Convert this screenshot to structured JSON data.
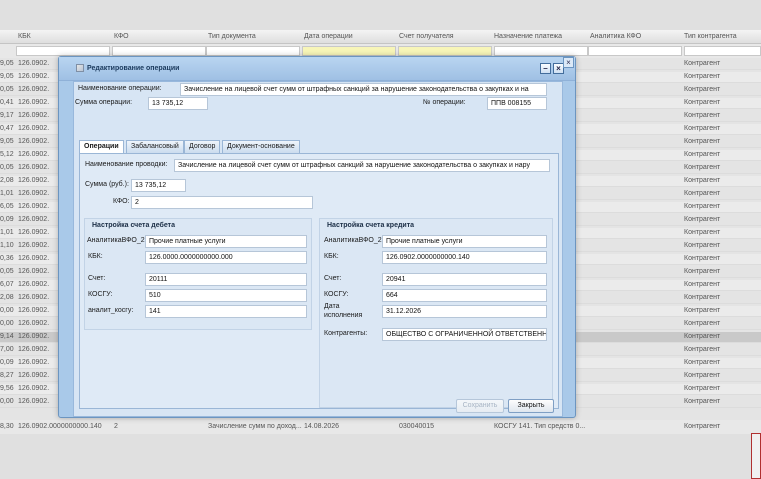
{
  "grid": {
    "columns": [
      "КБК",
      "КФО",
      "Тип документа",
      "Дата операции",
      "Счет получателя",
      "Назначение платежа",
      "Аналитика КФО",
      "Тип контрагента"
    ],
    "row_prefixes": [
      "9,05",
      "9,05",
      "0,05",
      "0,41",
      "9,17",
      "0,47",
      "9,05",
      "5,12",
      "0,05",
      "2,08",
      "1,01",
      "6,05",
      "0,09",
      "1,01",
      "1,10",
      "0,36",
      "0,05",
      "6,07",
      "2,08",
      "0,00",
      "0,00",
      "9,14",
      "7,00",
      "0,09",
      "8,27",
      "9,56",
      "0,00"
    ],
    "row_kbk": "126.0902.",
    "row_contr": "Контрагент",
    "last_row": {
      "prefix": "8,30",
      "kbk": "126.0902.0000000000.140",
      "kfo": "2",
      "doc": "Зачисление сумм по доход...",
      "date": "14.08.2026",
      "account": "030040015",
      "purpose": "КОСГУ 141. Тип средств 0...",
      "contr": "Контрагент"
    }
  },
  "dialog": {
    "title": "Редактирование операции",
    "op_name_label": "Наименование операции:",
    "op_name_value": "Зачисление на лицевой счет сумм от штрафных санкций за нарушение законодательства о закупках и на",
    "op_sum_label": "Сумма операции:",
    "op_sum_value": "13 735,12",
    "op_num_label": "№ операции:",
    "op_num_value": "ППВ 008155",
    "tabs": [
      "Операции",
      "Забалансовый",
      "Договор",
      "Документ-основание"
    ],
    "posting_name_label": "Наименование проводки:",
    "posting_name_value": "Зачисление на лицевой счет сумм от штрафных санкций за нарушение законодательства о закупках и нару",
    "sum_label": "Сумма (руб.):",
    "sum_value": "13 735,12",
    "kfo_label": "КФО:",
    "kfo_value": "2",
    "debit": {
      "title": "Настройка счета дебета",
      "analytics_label": "АналитикаВФО_2",
      "analytics_value": "Прочие платные услуги",
      "kbk_label": "КБК:",
      "kbk_value": "126.0000.0000000000.000",
      "account_label": "Счет:",
      "account_value": "20111",
      "kosgu_label": "КОСГУ:",
      "kosgu_value": "510",
      "akosgu_label": "аналит_косгу:",
      "akosgu_value": "141"
    },
    "credit": {
      "title": "Настройка счета кредита",
      "analytics_label": "АналитикаВФО_2",
      "analytics_value": "Прочие платные услуги",
      "kbk_label": "КБК:",
      "kbk_value": "126.0902.0000000000.140",
      "account_label": "Счет:",
      "account_value": "20941",
      "kosgu_label": "КОСГУ:",
      "kosgu_value": "664",
      "date_label_1": "Дата",
      "date_label_2": "исполнения",
      "date_value": "31.12.2026",
      "contr_label": "Контрагенты:",
      "contr_value": "ОБЩЕСТВО С ОГРАНИЧЕННОЙ ОТВЕТСТВЕНН"
    },
    "save_label": "Сохранить",
    "close_label": "Закрыть",
    "collapse_glyph": "–",
    "close_glyph": "×"
  }
}
